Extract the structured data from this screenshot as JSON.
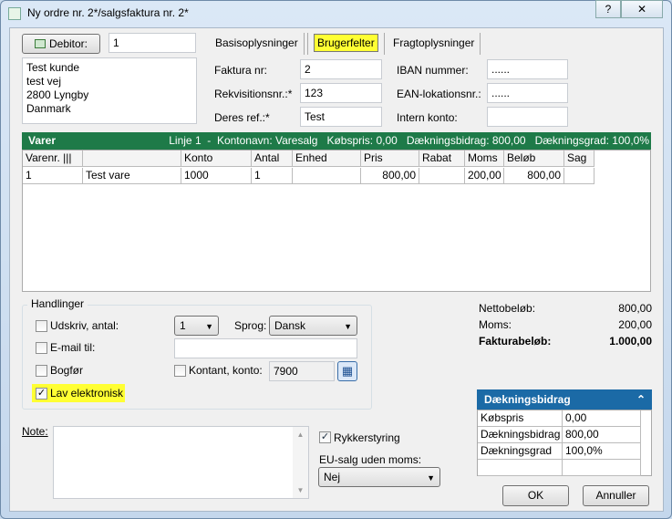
{
  "window": {
    "title": "Ny ordre nr. 2*/salgsfaktura nr. 2*",
    "help": "?",
    "close": "✕"
  },
  "debitor": {
    "button": "Debitor:",
    "value": "1",
    "address": [
      "Test kunde",
      "test vej",
      "2800 Lyngby",
      "Danmark"
    ]
  },
  "tabs": [
    "Basisoplysninger",
    "Brugerfelter",
    "Fragtoplysninger"
  ],
  "fields": {
    "faktura_label": "Faktura nr:",
    "faktura": "2",
    "rekv_label": "Rekvisitionsnr.:*",
    "rekv": "123",
    "ref_label": "Deres ref.:*",
    "ref": "Test",
    "iban_label": "IBAN nummer:",
    "iban": "......",
    "ean_label": "EAN-lokationsnr.:",
    "ean": "......",
    "intern_label": "Intern konto:",
    "intern": ""
  },
  "varer": {
    "title": "Varer",
    "info": "Linje 1  -  Kontonavn: Varesalg   Købspris: 0,00   Dækningsbidrag: 800,00   Dækningsgrad: 100,0%",
    "columns": [
      "Varenr. |||",
      "",
      "Konto",
      "Antal",
      "Enhed",
      "Pris",
      "Rabat",
      "Moms",
      "Beløb",
      "Sag"
    ],
    "rows": [
      [
        "1",
        "Test vare",
        "1000",
        "1",
        "",
        "800,00",
        "",
        "200,00",
        "800,00",
        ""
      ]
    ]
  },
  "handlinger": {
    "title": "Handlinger",
    "udskriv": "Udskriv, antal:",
    "antal": "1",
    "sprog_label": "Sprog:",
    "sprog": "Dansk",
    "email": "E-mail til:",
    "email_value": "",
    "bogfor": "Bogfør",
    "kontant": "Kontant, konto:",
    "konto": "7900",
    "lav": "Lav elektronisk"
  },
  "totals": {
    "netto_label": "Nettobeløb:",
    "netto": "800,00",
    "moms_label": "Moms:",
    "moms": "200,00",
    "faktura_label": "Fakturabeløb:",
    "faktura": "1.000,00"
  },
  "db": {
    "title": "Dækningsbidrag",
    "rows": [
      [
        "Købspris",
        "0,00"
      ],
      [
        "Dækningsbidrag",
        "800,00"
      ],
      [
        "Dækningsgrad",
        "100,0%"
      ]
    ]
  },
  "note_label": "Note:",
  "rykker": "Rykkerstyring",
  "eu_label": "EU-salg uden moms:",
  "eu": "Nej",
  "ok": "OK",
  "cancel": "Annuller"
}
